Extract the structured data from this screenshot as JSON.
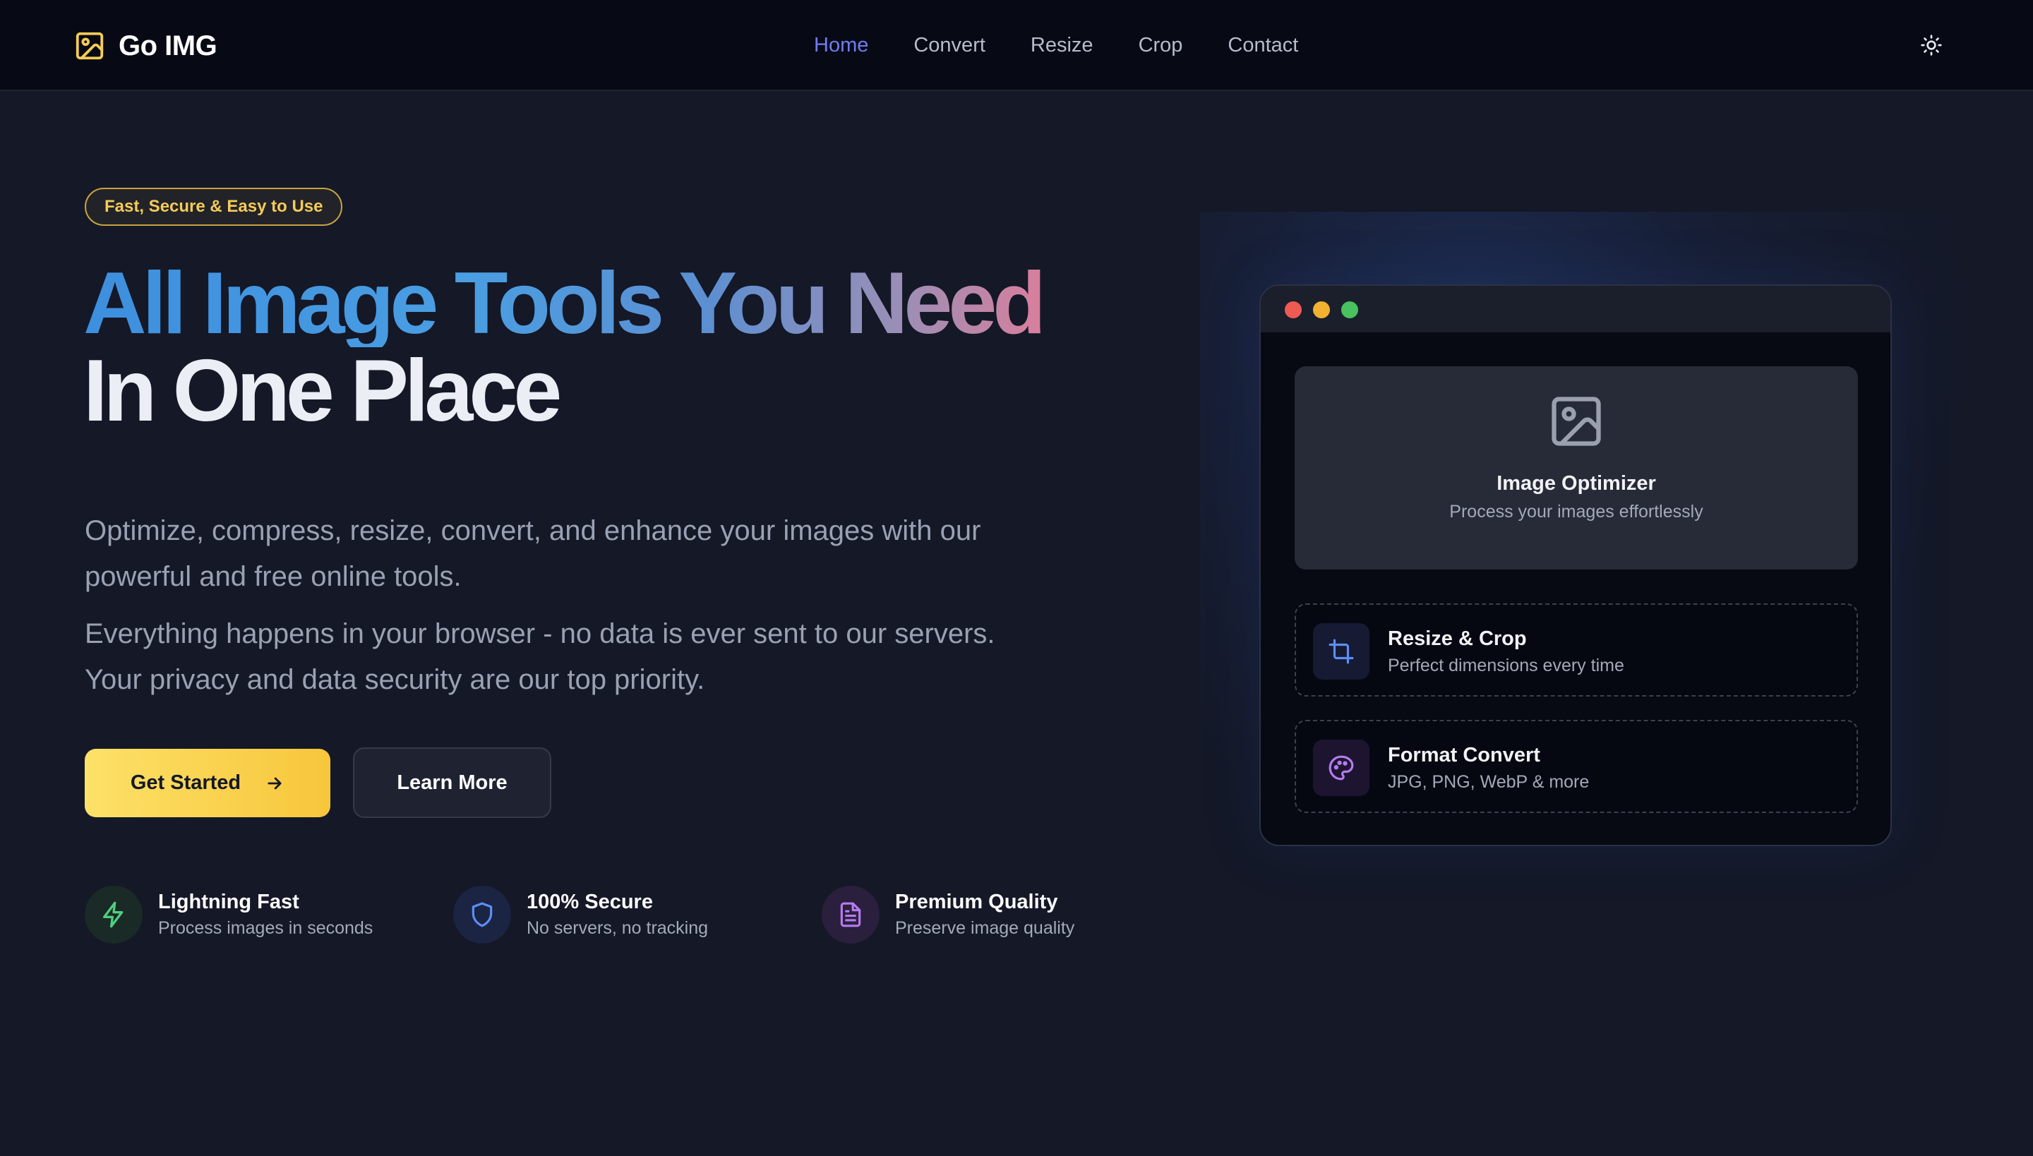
{
  "brand": {
    "name": "Go IMG",
    "icon": "image-icon",
    "accent": "#f4cb58"
  },
  "nav": {
    "items": [
      {
        "label": "Home",
        "active": true
      },
      {
        "label": "Convert",
        "active": false
      },
      {
        "label": "Resize",
        "active": false
      },
      {
        "label": "Crop",
        "active": false
      },
      {
        "label": "Contact",
        "active": false
      }
    ],
    "active_color": "#6f7cf6",
    "theme_toggle_icon": "sun-icon"
  },
  "hero": {
    "badge": "Fast, Secure & Easy to Use",
    "headline_line1": "All Image Tools You Need",
    "headline_line2": "In One Place",
    "description_1": "Optimize, compress, resize, convert, and enhance your images with our powerful and free online tools.",
    "description_2": "Everything happens in your browser - no data is ever sent to our servers. Your privacy and data security are our top priority.",
    "primary_button": "Get Started",
    "primary_button_icon": "arrow-right-icon",
    "secondary_button": "Learn More"
  },
  "features": [
    {
      "title": "Lightning Fast",
      "subtitle": "Process images in seconds",
      "icon": "lightning-icon",
      "color": "#4fcf7e"
    },
    {
      "title": "100% Secure",
      "subtitle": "No servers, no tracking",
      "icon": "shield-icon",
      "color": "#5b8ff9"
    },
    {
      "title": "Premium Quality",
      "subtitle": "Preserve image quality",
      "icon": "document-icon",
      "color": "#b57cf0"
    }
  ],
  "preview": {
    "window_dots": [
      "#ee5b52",
      "#f2b22f",
      "#48c15f"
    ],
    "optimizer_title": "Image Optimizer",
    "optimizer_subtitle": "Process your images effortlessly",
    "optimizer_icon": "image-icon",
    "tools": [
      {
        "title": "Resize & Crop",
        "subtitle": "Perfect dimensions every time",
        "icon": "crop-icon",
        "color": "#5b8ff9"
      },
      {
        "title": "Format Convert",
        "subtitle": "JPG, PNG, WebP & more",
        "icon": "palette-icon",
        "color": "#b57cf0"
      }
    ]
  }
}
